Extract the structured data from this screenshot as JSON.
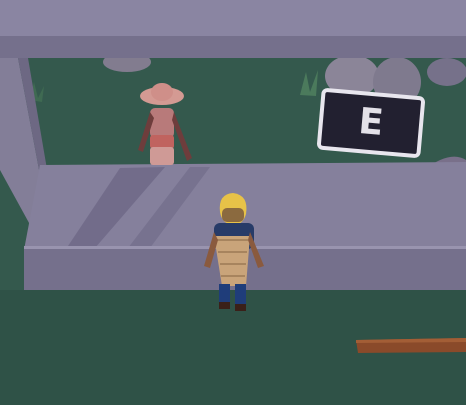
{
  "hud": {
    "interact_prompt": {
      "key": "E",
      "icon": "keyboard-key-icon"
    }
  },
  "colors": {
    "grass": "#34594d",
    "grass_dark": "#284840",
    "stone_wall": "#7b7791",
    "stone_wall_top": "#8f8aa5",
    "prompt_bg": "#222030",
    "prompt_border": "#e8e6ee",
    "wood_plank": "#8a4a2a"
  }
}
